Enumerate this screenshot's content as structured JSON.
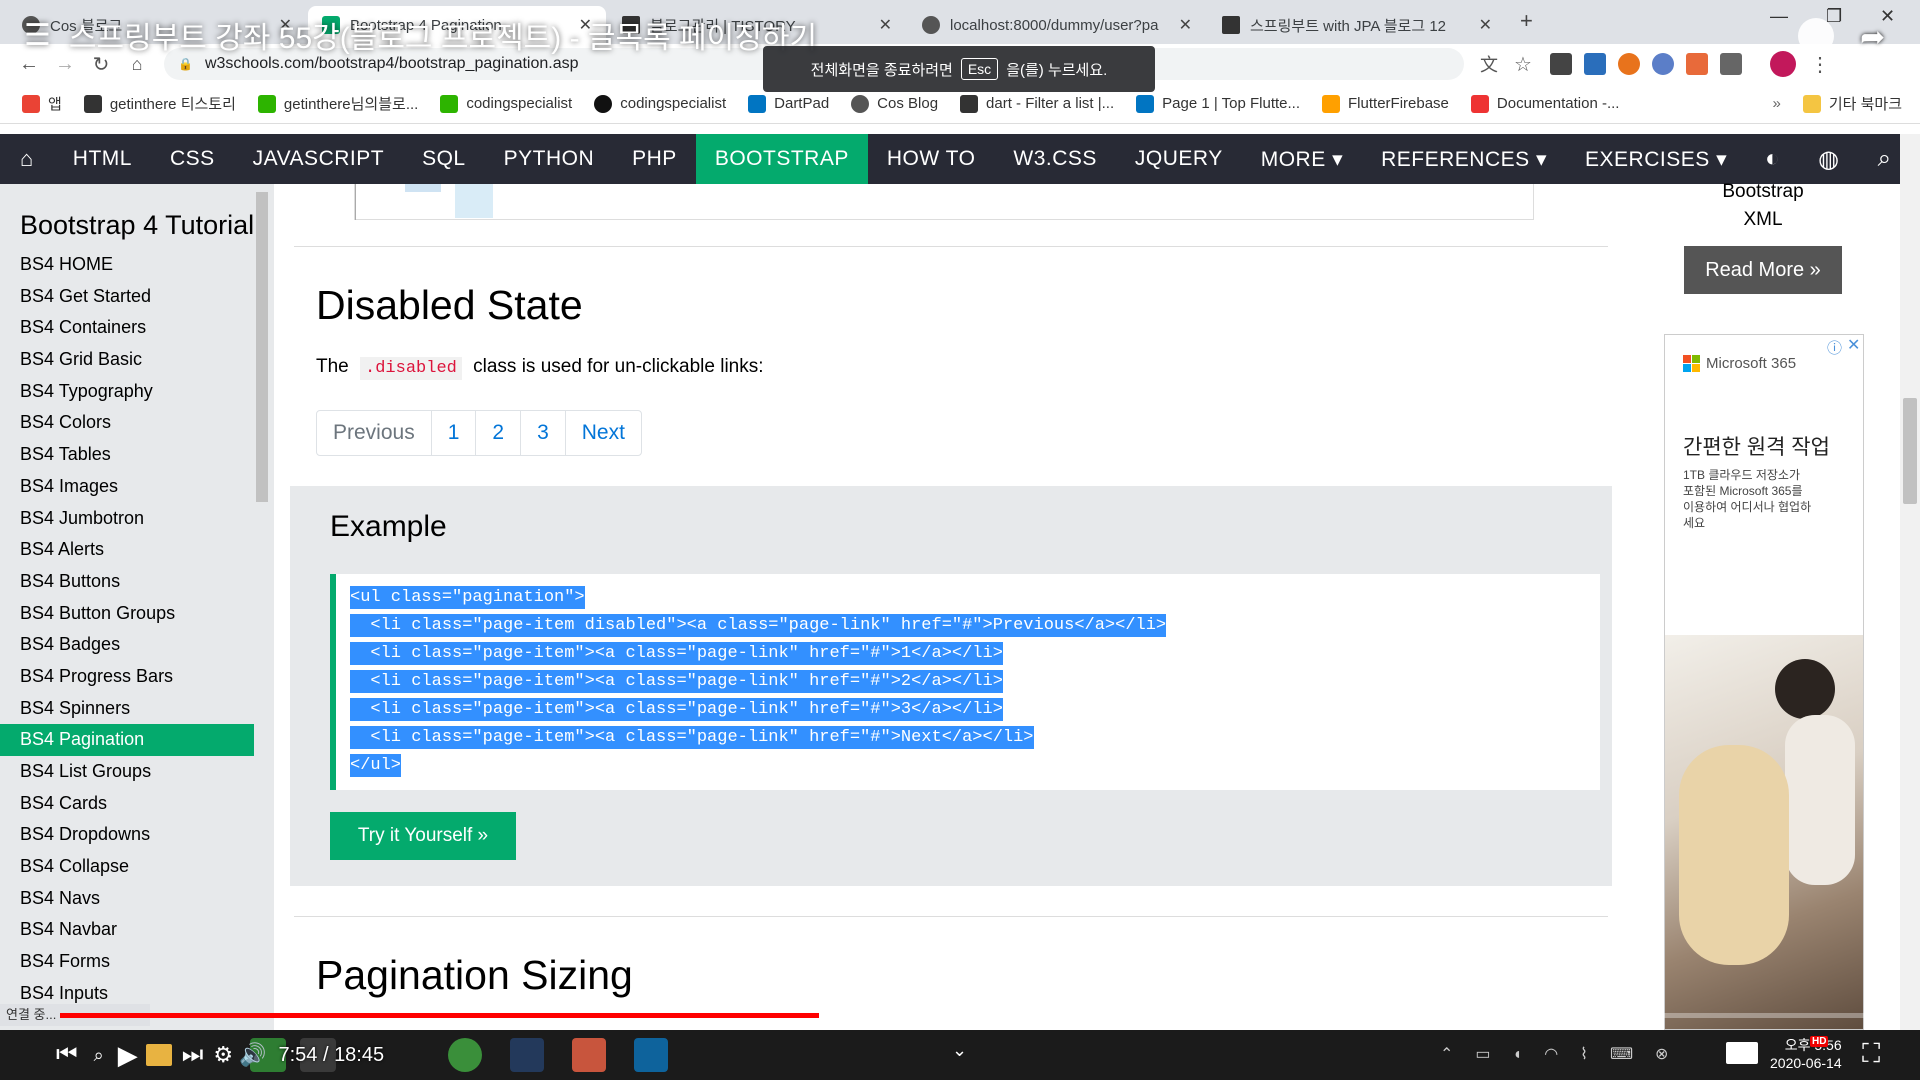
{
  "video": {
    "title": "스프링부트 강좌 55강(블로그 프로젝트) - 글목록 페이징하기",
    "time_current": "7:54",
    "time_total": "18:45",
    "progress": 0.42,
    "buffered": 0.5,
    "fullscreen_toast": {
      "before": "전체화면을 종료하려면",
      "key": "Esc",
      "after": "을(를) 누르세요."
    }
  },
  "browser": {
    "tabs": [
      {
        "label": "Cos 블로그"
      },
      {
        "label": "Bootstrap 4 Pagination",
        "active": true
      },
      {
        "label": "블로그관리 | TISTORY"
      },
      {
        "label": "localhost:8000/dummy/user?pa"
      },
      {
        "label": "스프링부트 with JPA 블로그 12"
      }
    ],
    "url": "w3schools.com/bootstrap4/bootstrap_pagination.asp",
    "bookmarks": [
      {
        "label": "앱",
        "color": "#ea4335"
      },
      {
        "label": "getinthere 티스토리",
        "color": "#333333"
      },
      {
        "label": "getinthere님의블로...",
        "color": "#2db400"
      },
      {
        "label": "codingspecialist",
        "color": "#2db400"
      },
      {
        "label": "codingspecialist",
        "color": "#111111"
      },
      {
        "label": "DartPad",
        "color": "#0175c2"
      },
      {
        "label": "Cos Blog",
        "color": "#555555"
      },
      {
        "label": "dart - Filter a list |...",
        "color": "#333333"
      },
      {
        "label": "Page 1 | Top Flutte...",
        "color": "#0175c2"
      },
      {
        "label": "FlutterFirebase",
        "color": "#ffa000"
      },
      {
        "label": "Documentation -...",
        "color": "#e33"
      }
    ],
    "bookmarks_other": "기타 북마크"
  },
  "nav": {
    "items": [
      "HTML",
      "CSS",
      "JAVASCRIPT",
      "SQL",
      "PYTHON",
      "PHP",
      "BOOTSTRAP",
      "HOW TO",
      "W3.CSS",
      "JQUERY",
      "MORE ▾",
      "REFERENCES ▾",
      "EXERCISES ▾"
    ],
    "active_index": 6,
    "accent": "#04aa6d",
    "bg": "#282a35"
  },
  "sidebar": {
    "title": "Bootstrap 4 Tutorial",
    "items": [
      "BS4 HOME",
      "BS4 Get Started",
      "BS4 Containers",
      "BS4 Grid Basic",
      "BS4 Typography",
      "BS4 Colors",
      "BS4 Tables",
      "BS4 Images",
      "BS4 Jumbotron",
      "BS4 Alerts",
      "BS4 Buttons",
      "BS4 Button Groups",
      "BS4 Badges",
      "BS4 Progress Bars",
      "BS4 Spinners",
      "BS4 Pagination",
      "BS4 List Groups",
      "BS4 Cards",
      "BS4 Dropdowns",
      "BS4 Collapse",
      "BS4 Navs",
      "BS4 Navbar",
      "BS4 Forms",
      "BS4 Inputs"
    ],
    "active_index": 15,
    "footer_status": "연결 중..."
  },
  "main": {
    "disabled_heading": "Disabled State",
    "desc_before": "The",
    "desc_code": ".disabled",
    "desc_after": "class is used for un-clickable links:",
    "pagination": [
      "Previous",
      "1",
      "2",
      "3",
      "Next"
    ],
    "example_heading": "Example",
    "code_lines": [
      "<ul class=\"pagination\">",
      "  <li class=\"page-item disabled\"><a class=\"page-link\" href=\"#\">Previous</a></li>",
      "  <li class=\"page-item\"><a class=\"page-link\" href=\"#\">1</a></li>",
      "  <li class=\"page-item\"><a class=\"page-link\" href=\"#\">2</a></li>",
      "  <li class=\"page-item\"><a class=\"page-link\" href=\"#\">3</a></li>",
      "  <li class=\"page-item\"><a class=\"page-link\" href=\"#\">Next</a></li>",
      "</ul>"
    ],
    "try_button": "Try it Yourself »",
    "next_heading": "Pagination Sizing"
  },
  "right": {
    "top_text_1": "Bootstrap",
    "top_text_2": "XML",
    "read_more": "Read More »",
    "ad_brand": "Microsoft 365",
    "ad_headline": "간편한 원격 작업",
    "ad_body": "1TB 클라우드 저장소가 포함된 Microsoft 365를 이용하여 어디서나 협업하세요"
  },
  "taskbar": {
    "clock_time": "오후 5:56",
    "clock_date": "2020-06-14"
  }
}
